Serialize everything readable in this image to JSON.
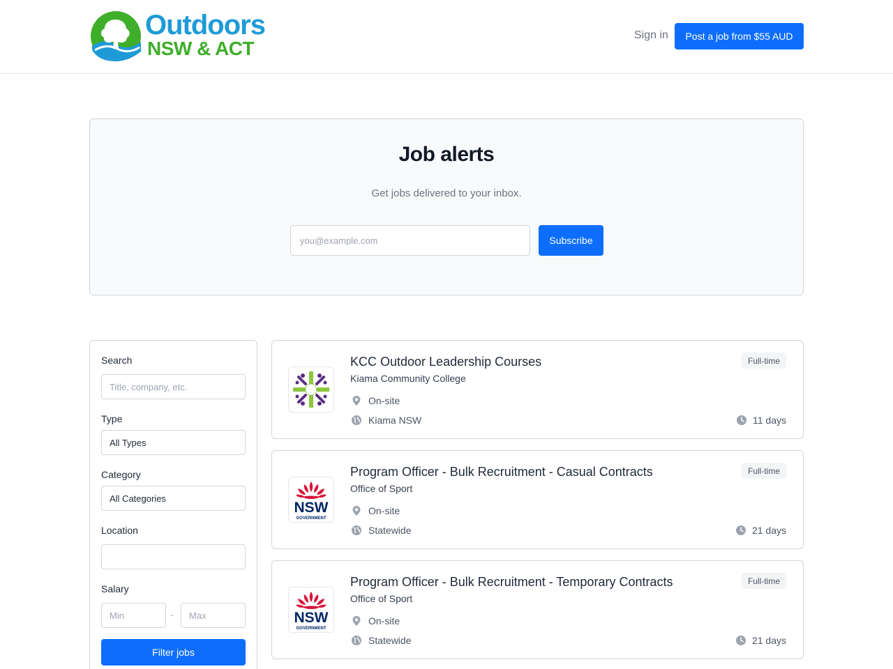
{
  "header": {
    "logo_line1": "Outdoors",
    "logo_line2": "NSW & ACT",
    "signin_label": "Sign in",
    "post_job_label": "Post a job from $55 AUD"
  },
  "alerts": {
    "title": "Job alerts",
    "subtitle": "Get jobs delivered to your inbox.",
    "email_placeholder": "you@example.com",
    "subscribe_label": "Subscribe"
  },
  "filters": {
    "search_label": "Search",
    "search_placeholder": "Title, company, etc.",
    "type_label": "Type",
    "type_value": "All Types",
    "category_label": "Category",
    "category_value": "All Categories",
    "location_label": "Location",
    "location_value": "",
    "salary_label": "Salary",
    "salary_min_placeholder": "Min",
    "salary_dash": "-",
    "salary_max_placeholder": "Max",
    "filter_button_label": "Filter jobs"
  },
  "jobs": [
    {
      "title": "KCC Outdoor Leadership Courses",
      "company": "Kiama Community College",
      "workplace": "On-site",
      "location": "Kiama NSW",
      "type": "Full-time",
      "age": "11 days",
      "logo_icon": "kcc-logo-icon"
    },
    {
      "title": "Program Officer - Bulk Recruitment - Casual Contracts",
      "company": "Office of Sport",
      "workplace": "On-site",
      "location": "Statewide",
      "type": "Full-time",
      "age": "21 days",
      "logo_icon": "nsw-government-logo-icon",
      "logo_text": "NSW",
      "logo_subtext": "GOVERNMENT"
    },
    {
      "title": "Program Officer - Bulk Recruitment - Temporary Contracts",
      "company": "Office of Sport",
      "workplace": "On-site",
      "location": "Statewide",
      "type": "Full-time",
      "age": "21 days",
      "logo_icon": "nsw-government-logo-icon",
      "logo_text": "NSW",
      "logo_subtext": "GOVERNMENT"
    }
  ],
  "colors": {
    "primary": "#0d6efd",
    "logo_blue": "#1e9bd7",
    "logo_green": "#3fae2a",
    "nsw_red": "#d7153a",
    "nsw_navy": "#002664"
  }
}
